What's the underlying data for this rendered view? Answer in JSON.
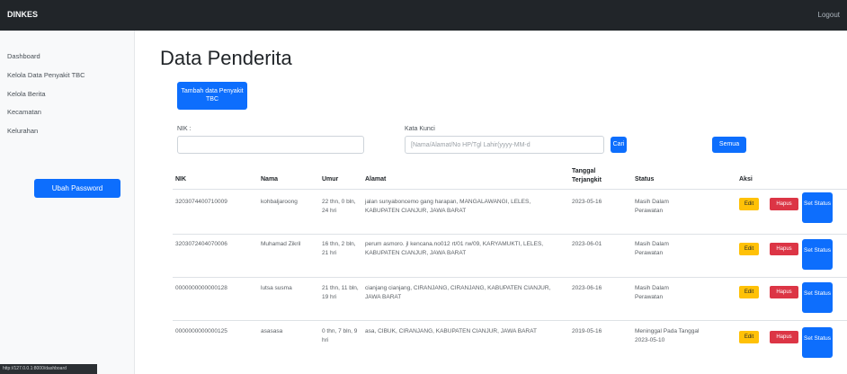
{
  "navbar": {
    "brand": "DINKES",
    "logout": "Logout"
  },
  "sidebar": {
    "items": [
      {
        "label": "Dashboard"
      },
      {
        "label": "Kelola Data Penyakit TBC"
      },
      {
        "label": "Kelola Berita"
      },
      {
        "label": "Kecamatan"
      },
      {
        "label": "Kelurahan"
      }
    ],
    "password_button": "Ubah Password"
  },
  "main": {
    "title": "Data Penderita",
    "add_button": "Tambah data Penyakit TBC",
    "filter": {
      "nik_label": "NIK :",
      "nik_value": "",
      "keyword_label": "Kata Kunci",
      "keyword_placeholder": "[Nama/Alamat/No HP/Tgl Lahir(yyyy-MM-d",
      "search_button": "Cari",
      "all_button": "Semua"
    },
    "table": {
      "headers": [
        "NIK",
        "Nama",
        "Umur",
        "Alamat",
        "Tanggal Terjangkit",
        "Status",
        "Aksi"
      ],
      "rows": [
        {
          "nik": "3203074400710009",
          "nama": "kohbaljaroong",
          "umur": "22 thn, 0 bln, 24 hri",
          "alamat": "jalan sunyaboncemo gang harapan, MANGALAWANGI, LELES, KABUPATEN CIANJUR, JAWA BARAT",
          "tanggal": "2023-05-16",
          "status": "Masih Dalam Perawatan"
        },
        {
          "nik": "3203072404070006",
          "nama": "Muhamad Zikril",
          "umur": "16 thn, 2 bln, 21 hri",
          "alamat": "perum asmoro. jl kencana.no012 rt/01 rw/09, KARYAMUKTI, LELES, KABUPATEN CIANJUR, JAWA BARAT",
          "tanggal": "2023-06-01",
          "status": "Masih Dalam Perawatan"
        },
        {
          "nik": "0000000000000128",
          "nama": "lutsa susma",
          "umur": "21 thn, 11 bln, 19 hri",
          "alamat": "cianjang cianjang, CIRANJANG, CIRANJANG, KABUPATEN CIANJUR, JAWA BARAT",
          "tanggal": "2023-06-16",
          "status": "Masih Dalam Perawatan"
        },
        {
          "nik": "0000000000000125",
          "nama": "asasasa",
          "umur": "0 thn, 7 bln, 9 hri",
          "alamat": "asa, CIBUK, CIRANJANG, KABUPATEN CIANJUR, JAWA BARAT",
          "tanggal": "2019-05-16",
          "status": "Meninggal Pada Tanggal 2023-05-10"
        }
      ],
      "actions": {
        "edit": "Edit",
        "delete": "Hapus",
        "set_status": "Set Status"
      }
    }
  },
  "status_bar": {
    "url": "http://127.0.0.1:8000/dashboard"
  },
  "colors": {
    "navbar": "#212529",
    "primary": "#0d6efd",
    "warning": "#ffc107",
    "danger": "#dc3545"
  }
}
